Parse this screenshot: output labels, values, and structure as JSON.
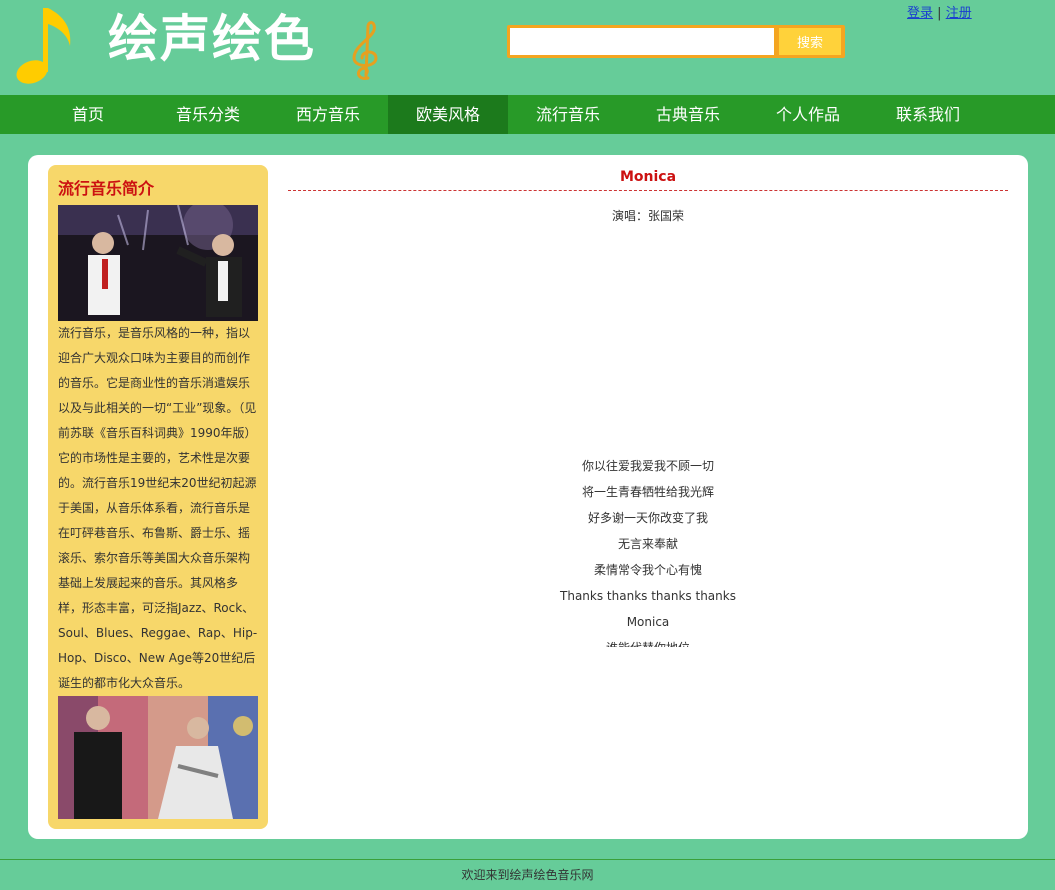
{
  "header": {
    "logo_text": "绘声绘色",
    "search_placeholder": "",
    "search_button_label": "搜索",
    "login_label": "登录",
    "separator": "|",
    "register_label": "注册"
  },
  "nav": {
    "items": [
      "首页",
      "音乐分类",
      "西方音乐",
      "欧美风格",
      "流行音乐",
      "古典音乐",
      "个人作品",
      "联系我们"
    ],
    "active": "欧美风格"
  },
  "sidebar": {
    "title": "流行音乐简介",
    "text": "流行音乐，是音乐风格的一种，指以迎合广大观众口味为主要目的而创作的音乐。它是商业性的音乐消遣娱乐以及与此相关的一切“工业”现象。（见前苏联《音乐百科词典》1990年版）它的市场性是主要的，艺术性是次要的。流行音乐19世纪末20世纪初起源于美国，从音乐体系看，流行音乐是在叮砰巷音乐、布鲁斯、爵士乐、摇滚乐、索尔音乐等美国大众音乐架构基础上发展起来的音乐。其风格多样，形态丰富，可泛指Jazz、Rock、Soul、Blues、Reggae、Rap、Hip-Hop、Disco、New Age等20世纪后诞生的都市化大众音乐。"
  },
  "song": {
    "title": "Monica",
    "singer": "演唱：张国荣",
    "lyrics": [
      "你以往爱我爱我不顾一切",
      "将一生青春牺牲给我光辉",
      "好多谢一天你改变了我",
      "无言来奉献",
      "柔情常令我个心有愧",
      "Thanks thanks thanks thanks",
      "Monica",
      "谁能代替你地位"
    ]
  },
  "footer": {
    "text": "欢迎来到绘声绘色音乐网"
  },
  "colors": {
    "background": "#66cc99",
    "nav": "#289a28",
    "nav_active": "#1c7a1c",
    "sidebar": "#f7d76a",
    "accent_red": "#cc1111",
    "search_orange": "#f4a520"
  }
}
